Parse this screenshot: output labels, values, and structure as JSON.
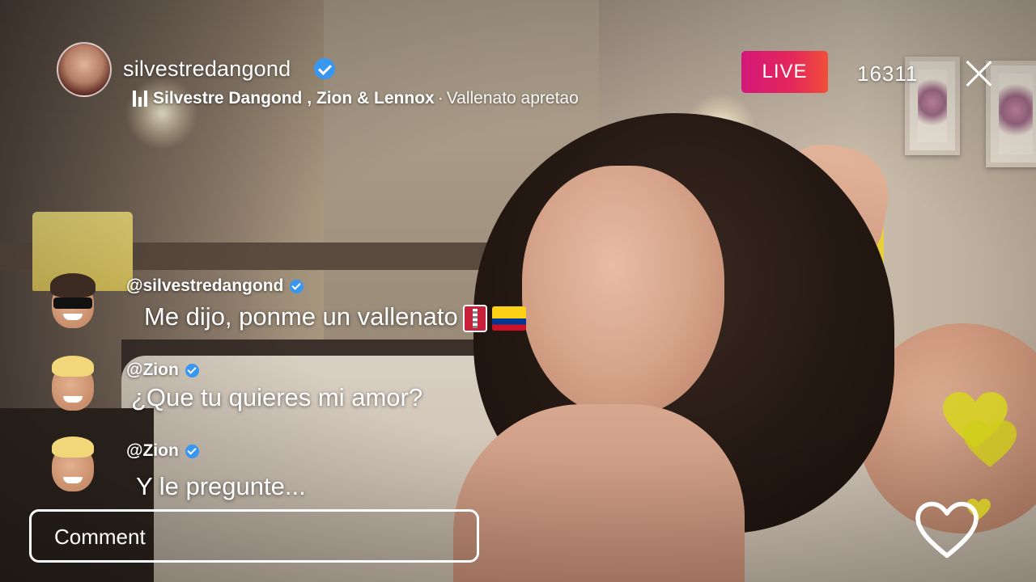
{
  "header": {
    "username": "silvestredangond",
    "music_artists": "Silvestre Dangond , Zion & Lennox",
    "music_separator": "·",
    "music_song": "Vallenato apretao",
    "live_label": "LIVE",
    "viewer_count": "16311"
  },
  "comments": [
    {
      "user": "@silvestredangond",
      "text": "Me dijo, ponme un vallenato",
      "avatar": "memoji-sunglasses",
      "emojis": [
        "accordion-emoji",
        "colombia-flag-emoji"
      ]
    },
    {
      "user": "@Zion",
      "text": "¿Que tu quieres mi amor?",
      "avatar": "memoji-blond"
    },
    {
      "user": "@Zion",
      "text": "Y le pregunte...",
      "avatar": "memoji-blond"
    }
  ],
  "comment_input": {
    "placeholder": "Comment"
  },
  "icons": {
    "close": "close-icon",
    "verified": "verified-badge-icon",
    "music": "music-bars-icon",
    "like": "heart-outline-icon",
    "floating_hearts": "heart-icon"
  },
  "colors": {
    "live_gradient_start": "#d3177a",
    "live_gradient_end": "#f0503a",
    "verified": "#3897f0",
    "floating_heart": "#d8d61e"
  }
}
